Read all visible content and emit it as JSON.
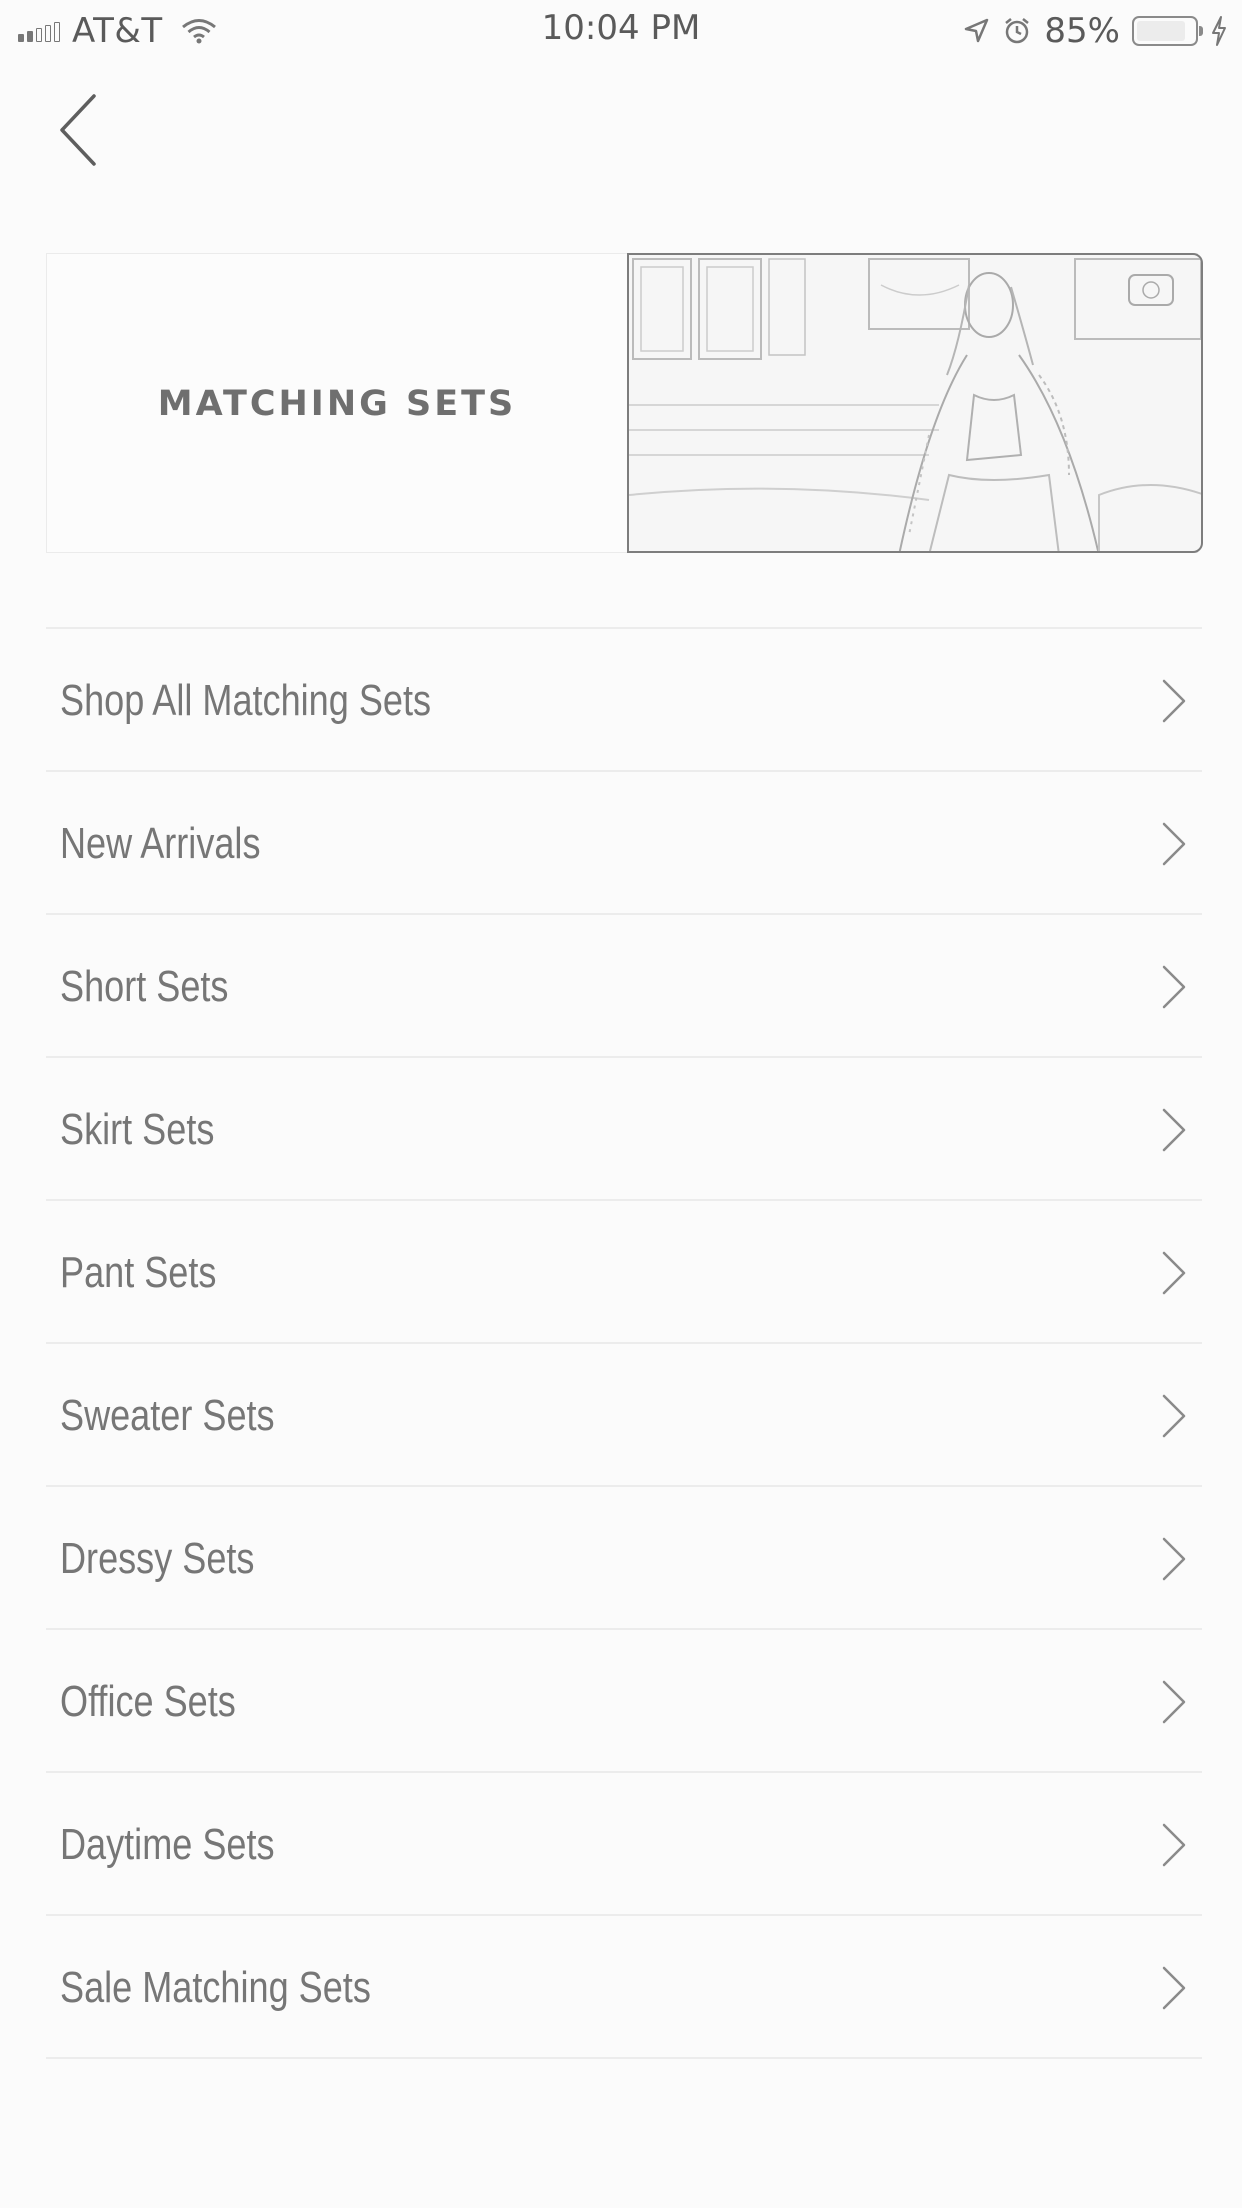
{
  "status_bar": {
    "carrier": "AT&T",
    "time": "10:04 PM",
    "battery_percent": "85%",
    "battery_level": 0.85,
    "icons": [
      "signal-icon",
      "wifi-icon",
      "location-icon",
      "alarm-icon",
      "battery-icon",
      "charging-icon"
    ]
  },
  "nav": {
    "back_icon": "chevron-left-icon"
  },
  "banner": {
    "title": "MATCHING SETS",
    "image": "fashion-photo"
  },
  "menu": {
    "items": [
      {
        "label": "Shop All Matching Sets"
      },
      {
        "label": "New Arrivals"
      },
      {
        "label": "Short Sets"
      },
      {
        "label": "Skirt Sets"
      },
      {
        "label": "Pant Sets"
      },
      {
        "label": "Sweater Sets"
      },
      {
        "label": "Dressy Sets"
      },
      {
        "label": "Office Sets"
      },
      {
        "label": "Daytime Sets"
      },
      {
        "label": "Sale Matching Sets"
      }
    ],
    "item_icon": "chevron-right-icon"
  },
  "colors": {
    "background": "#fbfbfb",
    "text": "#767676",
    "divider": "#ececec"
  }
}
